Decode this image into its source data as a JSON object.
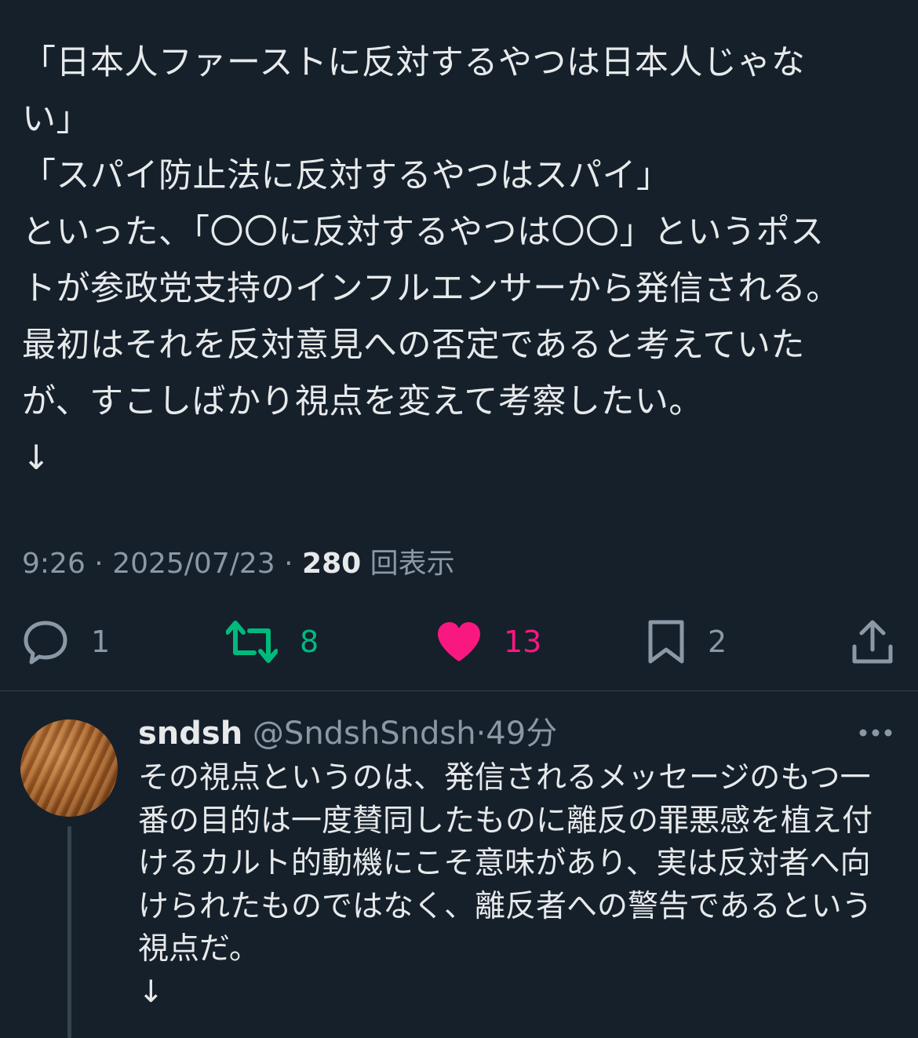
{
  "post": {
    "lines": [
      "「日本人ファーストに反対するやつは日本人じゃな",
      "い」",
      "「スパイ防止法に反対するやつはスパイ」",
      "といった、「〇〇に反対するやつは〇〇」というポス",
      "トが参政党支持のインフルエンサーから発信される。",
      "最初はそれを反対意見への否定であると考えていた",
      "が、すこしばかり視点を変えて考察したい。",
      "↓"
    ],
    "time": "9:26",
    "separator": " · ",
    "date": "2025/07/23",
    "views_count": "280",
    "views_label": "回表示"
  },
  "actions": {
    "reply": {
      "icon": "reply-icon",
      "count": "1"
    },
    "repost": {
      "icon": "repost-icon",
      "count": "8",
      "color": "#00ba7c"
    },
    "like": {
      "icon": "heart-icon",
      "count": "13",
      "color": "#f91880"
    },
    "bookmark": {
      "icon": "bookmark-icon",
      "count": "2"
    },
    "share": {
      "icon": "share-icon"
    }
  },
  "reply": {
    "name": "sndsh",
    "handle": "@SndshSndsh",
    "dot": "·",
    "time": "49分",
    "lines": [
      "その視点というのは、発信されるメッセージのもつ一",
      "番の目的は一度賛同したものに離反の罪悪感を植え付",
      "けるカルト的動機にこそ意味があり、実は反対者へ向",
      "けられたものではなく、離反者への警告であるという",
      "視点だ。",
      "↓"
    ]
  },
  "colors": {
    "background": "#15202b",
    "text": "#e7e9ea",
    "secondary": "#8b98a5",
    "divider": "#38444d"
  }
}
